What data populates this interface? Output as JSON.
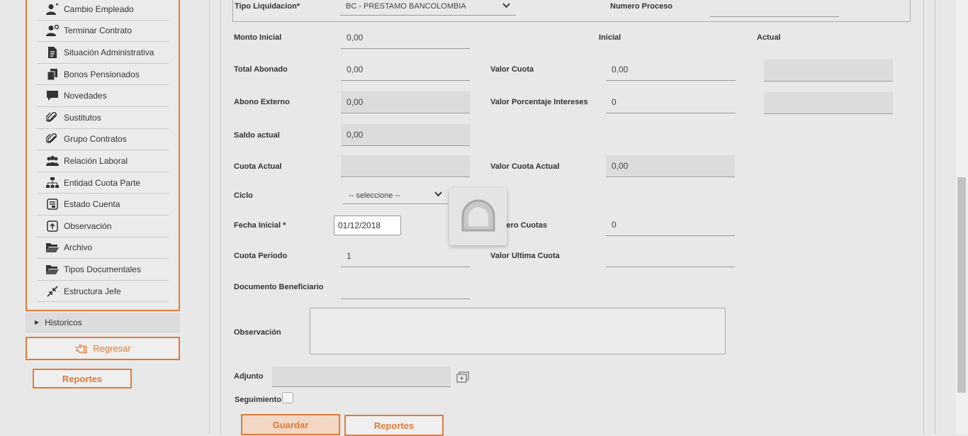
{
  "sidebar": {
    "items": [
      {
        "label": "Cambio Empleado",
        "icon": "user-edit-icon"
      },
      {
        "label": "Terminar Contrato",
        "icon": "user-remove-icon"
      },
      {
        "label": "Situación Administrativa",
        "icon": "document-icon"
      },
      {
        "label": "Bonos Pensionados",
        "icon": "copy-icon"
      },
      {
        "label": "Novedades",
        "icon": "comment-icon"
      },
      {
        "label": "Sustitutos",
        "icon": "paperclip-icon"
      },
      {
        "label": "Grupo Contratos",
        "icon": "paperclip-icon"
      },
      {
        "label": "Relación Laboral",
        "icon": "users-icon"
      },
      {
        "label": "Entidad Cuota Parte",
        "icon": "sitemap-icon"
      },
      {
        "label": "Estado Cuenta",
        "icon": "account-icon"
      },
      {
        "label": "Observación",
        "icon": "upload-box-icon"
      },
      {
        "label": "Archivo",
        "icon": "folder-open-icon"
      },
      {
        "label": "Tipos Documentales",
        "icon": "folder-open-icon"
      },
      {
        "label": "Estructura Jefe",
        "icon": "compress-icon"
      }
    ],
    "historicos_label": "Historicos",
    "regresar_label": "Regresar",
    "reportes_label": "Reportes"
  },
  "form": {
    "tipo_liquidacion": {
      "label": "Tipo Liquidacion*",
      "value": "BC - PRESTAMO BANCOLOMBIA"
    },
    "numero_proceso": {
      "label": "Numero Proceso",
      "value": ""
    },
    "col_inicial": "Inicial",
    "col_actual": "Actual",
    "monto_inicial": {
      "label": "Monto Inicial",
      "value": "0,00"
    },
    "total_abonado": {
      "label": "Total Abonado",
      "value": "0,00"
    },
    "valor_cuota": {
      "label": "Valor Cuota",
      "inicial": "0,00",
      "actual": ""
    },
    "abono_externo": {
      "label": "Abono Externo",
      "value": "0,00"
    },
    "valor_porcentaje_intereses": {
      "label": "Valor Porcentaje Intereses",
      "inicial": "0",
      "actual": ""
    },
    "saldo_actual": {
      "label": "Saldo actual",
      "value": "0,00"
    },
    "cuota_actual": {
      "label": "Cuota Actual",
      "value": ""
    },
    "valor_cuota_actual": {
      "label": "Valor Cuota Actual",
      "value": "0,00"
    },
    "ciclo": {
      "label": "Ciclo",
      "value": "-- seleccione --"
    },
    "fecha_inicial": {
      "label": "Fecha Inicial *",
      "value": "01/12/2018"
    },
    "numero_cuotas": {
      "label": "úmero Cuotas",
      "value": "0"
    },
    "cuota_periodo": {
      "label": "Cuota Periodo",
      "value": "1"
    },
    "valor_ultima_cuota": {
      "label": "Valor Ultima Cuota",
      "value": ""
    },
    "documento_beneficiario": {
      "label": "Documento Beneficiario",
      "value": ""
    },
    "observacion": {
      "label": "Observación",
      "value": ""
    },
    "adjunto": {
      "label": "Adjunto",
      "value": ""
    },
    "seguimiento": {
      "label": "Seguimiento",
      "checked": false
    }
  },
  "actions": {
    "guardar_label": "Guardar",
    "reportes_label": "Reportes"
  },
  "colors": {
    "accent": "#e07b39",
    "background": "#e8e8e8",
    "readonly_field": "#dcdcdc"
  }
}
